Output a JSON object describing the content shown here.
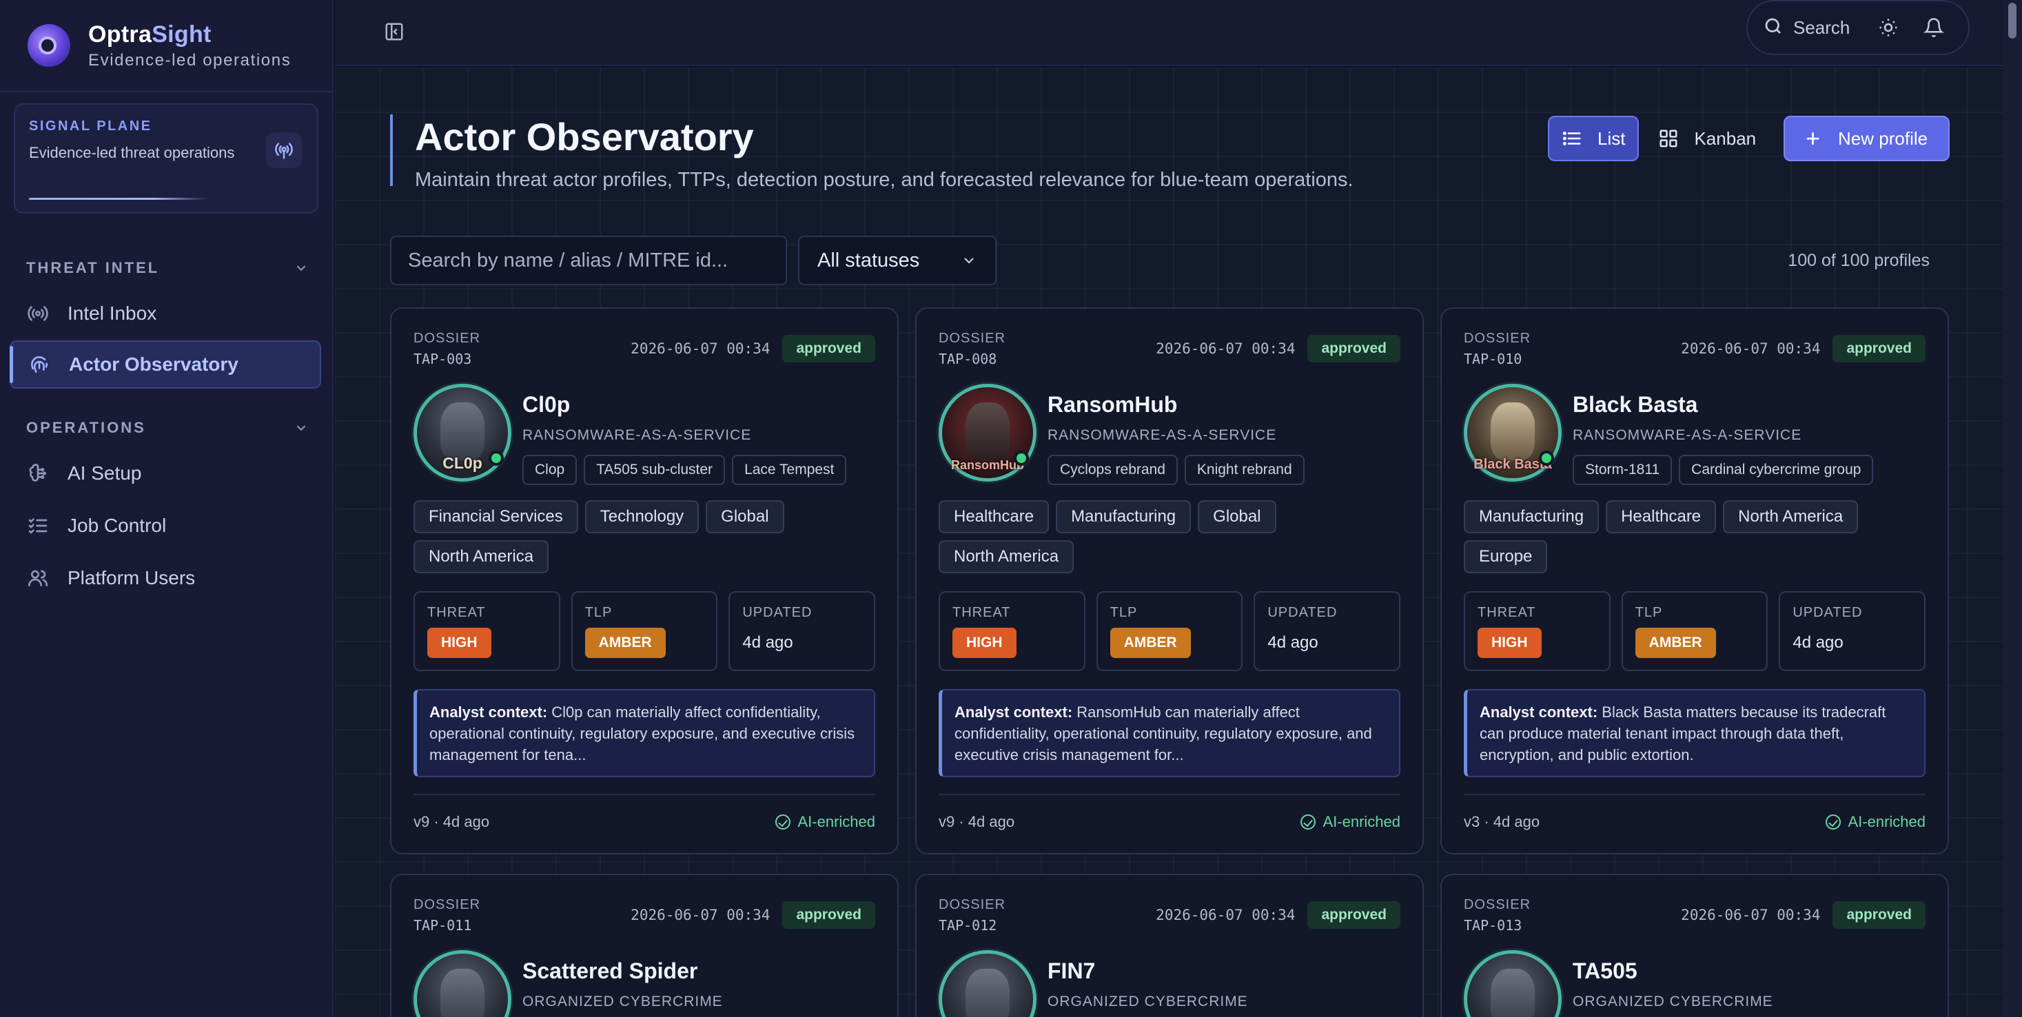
{
  "brand": {
    "name_prefix": "Optra",
    "name_accent": "Sight",
    "subtitle": "Evidence-led operations"
  },
  "signal_plane": {
    "kicker": "SIGNAL PLANE",
    "text": "Evidence-led threat operations"
  },
  "nav": {
    "threat_intel_label": "THREAT INTEL",
    "operations_label": "OPERATIONS",
    "items": [
      {
        "label": "Intel Inbox"
      },
      {
        "label": "Actor Observatory"
      },
      {
        "label": "AI Setup"
      },
      {
        "label": "Job Control"
      },
      {
        "label": "Platform Users"
      }
    ]
  },
  "topbar": {
    "search_label": "Search"
  },
  "page": {
    "title": "Actor Observatory",
    "subtitle": "Maintain threat actor profiles, TTPs, detection posture, and forecasted relevance for blue-team operations.",
    "view_list": "List",
    "view_kanban": "Kanban",
    "new_profile": "New profile",
    "search_placeholder": "Search by name / alias / MITRE id...",
    "status_filter": "All statuses",
    "count": "100 of 100 profiles"
  },
  "labels": {
    "dossier": "DOSSIER",
    "threat": "THREAT",
    "tlp": "TLP",
    "updated": "UPDATED",
    "analyst_context": "Analyst context:",
    "ai_enriched": "AI-enriched"
  },
  "cards": [
    {
      "id": "TAP-003",
      "timestamp": "2026-06-07 00:34",
      "status": "approved",
      "avatar_text": "CL0p",
      "name": "Cl0p",
      "category": "RANSOMWARE-AS-A-SERVICE",
      "aliases": [
        "Clop",
        "TA505 sub-cluster",
        "Lace Tempest"
      ],
      "sectors": [
        "Financial Services",
        "Technology",
        "Global",
        "North America"
      ],
      "threat": "HIGH",
      "tlp": "AMBER",
      "updated": "4d ago",
      "context": "Cl0p can materially affect confidentiality, operational continuity, regulatory exposure, and executive crisis management for tena...",
      "version": "v9 · 4d ago"
    },
    {
      "id": "TAP-008",
      "timestamp": "2026-06-07 00:34",
      "status": "approved",
      "avatar_text": "RansomHub",
      "name": "RansomHub",
      "category": "RANSOMWARE-AS-A-SERVICE",
      "aliases": [
        "Cyclops rebrand",
        "Knight rebrand"
      ],
      "sectors": [
        "Healthcare",
        "Manufacturing",
        "Global",
        "North America"
      ],
      "threat": "HIGH",
      "tlp": "AMBER",
      "updated": "4d ago",
      "context": "RansomHub can materially affect confidentiality, operational continuity, regulatory exposure, and executive crisis management for...",
      "version": "v9 · 4d ago"
    },
    {
      "id": "TAP-010",
      "timestamp": "2026-06-07 00:34",
      "status": "approved",
      "avatar_text": "Black Basta",
      "name": "Black Basta",
      "category": "RANSOMWARE-AS-A-SERVICE",
      "aliases": [
        "Storm-1811",
        "Cardinal cybercrime group"
      ],
      "sectors": [
        "Manufacturing",
        "Healthcare",
        "North America",
        "Europe"
      ],
      "threat": "HIGH",
      "tlp": "AMBER",
      "updated": "4d ago",
      "context": "Black Basta matters because its tradecraft can produce material tenant impact through data theft, encryption, and public extortion.",
      "version": "v3 · 4d ago"
    },
    {
      "id": "TAP-011",
      "timestamp": "2026-06-07 00:34",
      "status": "approved",
      "name": "Scattered Spider",
      "category": "ORGANIZED CYBERCRIME"
    },
    {
      "id": "TAP-012",
      "timestamp": "2026-06-07 00:34",
      "status": "approved",
      "name": "FIN7",
      "category": "ORGANIZED CYBERCRIME"
    },
    {
      "id": "TAP-013",
      "timestamp": "2026-06-07 00:34",
      "status": "approved",
      "name": "TA505",
      "category": "ORGANIZED CYBERCRIME"
    }
  ],
  "colors": {
    "accent": "#5c68e6",
    "threat_high": "#dc5a23",
    "tlp_amber": "#c9771f",
    "approved": "#17352a",
    "enriched": "#6bd4a0"
  }
}
